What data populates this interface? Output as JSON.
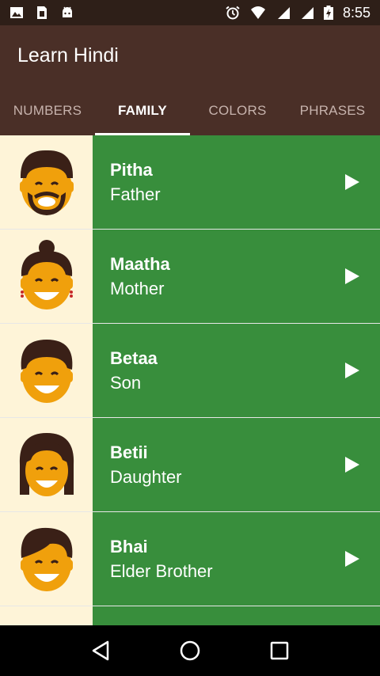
{
  "status": {
    "time": "8:55",
    "icons": [
      "image-icon",
      "sim-card-icon",
      "android-icon",
      "alarm-icon",
      "wifi-icon",
      "signal-icon",
      "signal-icon",
      "battery-charging-icon"
    ]
  },
  "app": {
    "title": "Learn Hindi",
    "bar_color": "#4a2f27",
    "status_color": "#2e1f18"
  },
  "tabs": [
    {
      "label": "NUMBERS",
      "active": false
    },
    {
      "label": "FAMILY",
      "active": true
    },
    {
      "label": "COLORS",
      "active": false
    },
    {
      "label": "PHRASES",
      "active": false
    }
  ],
  "list": {
    "accent": "#388e3c",
    "avatar_bg": "#fef4d8",
    "items": [
      {
        "hindi": "Pitha",
        "english": "Father",
        "icon": "father-avatar-icon"
      },
      {
        "hindi": "Maatha",
        "english": "Mother",
        "icon": "mother-avatar-icon"
      },
      {
        "hindi": "Betaa",
        "english": "Son",
        "icon": "son-avatar-icon"
      },
      {
        "hindi": "Betii",
        "english": "Daughter",
        "icon": "daughter-avatar-icon"
      },
      {
        "hindi": "Bhai",
        "english": "Elder Brother",
        "icon": "brother-avatar-icon"
      },
      {
        "hindi": "",
        "english": "",
        "icon": "avatar-icon"
      }
    ]
  },
  "nav": {
    "buttons": [
      "back-icon",
      "home-icon",
      "recents-icon"
    ]
  }
}
